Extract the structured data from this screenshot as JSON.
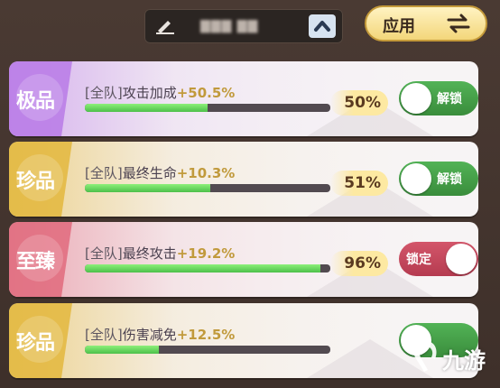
{
  "header": {
    "name_value": "▇▇▇ ▇▇",
    "apply_label": "应用",
    "icons": {
      "edit": "pencil-icon",
      "collapse": "chevron-up-icon",
      "swap": "swap-arrows-icon"
    }
  },
  "cards": [
    {
      "badge": "极品",
      "badge_color": "#b97ae6",
      "prefix": "[全队]",
      "stat": "攻击加成",
      "value": "+50.5%",
      "progress": 0.5,
      "percent_label": "50%",
      "toggle_label": "解锁",
      "toggle_on": true
    },
    {
      "badge": "珍品",
      "badge_color": "#e3b73d",
      "prefix": "[全队]",
      "stat": "最终生命",
      "value": "+10.3%",
      "progress": 0.51,
      "percent_label": "51%",
      "toggle_label": "解锁",
      "toggle_on": true
    },
    {
      "badge": "至臻",
      "badge_color": "#e06a7d",
      "prefix": "[全队]",
      "stat": "最终攻击",
      "value": "+19.2%",
      "progress": 0.96,
      "percent_label": "96%",
      "toggle_label": "锁定",
      "toggle_on": false
    },
    {
      "badge": "珍品",
      "badge_color": "#e3b73d",
      "prefix": "[全队]",
      "stat": "伤害减免",
      "value": "+12.5%",
      "progress": 0.3,
      "percent_label": "",
      "toggle_label": "",
      "toggle_on": true
    }
  ],
  "watermark": {
    "text": "九游"
  },
  "colors": {
    "toggle_on": "#4aa64d",
    "toggle_off": "#c94a5e",
    "progress_fill": "#5fd65a",
    "value_text": "#c19a3c"
  }
}
